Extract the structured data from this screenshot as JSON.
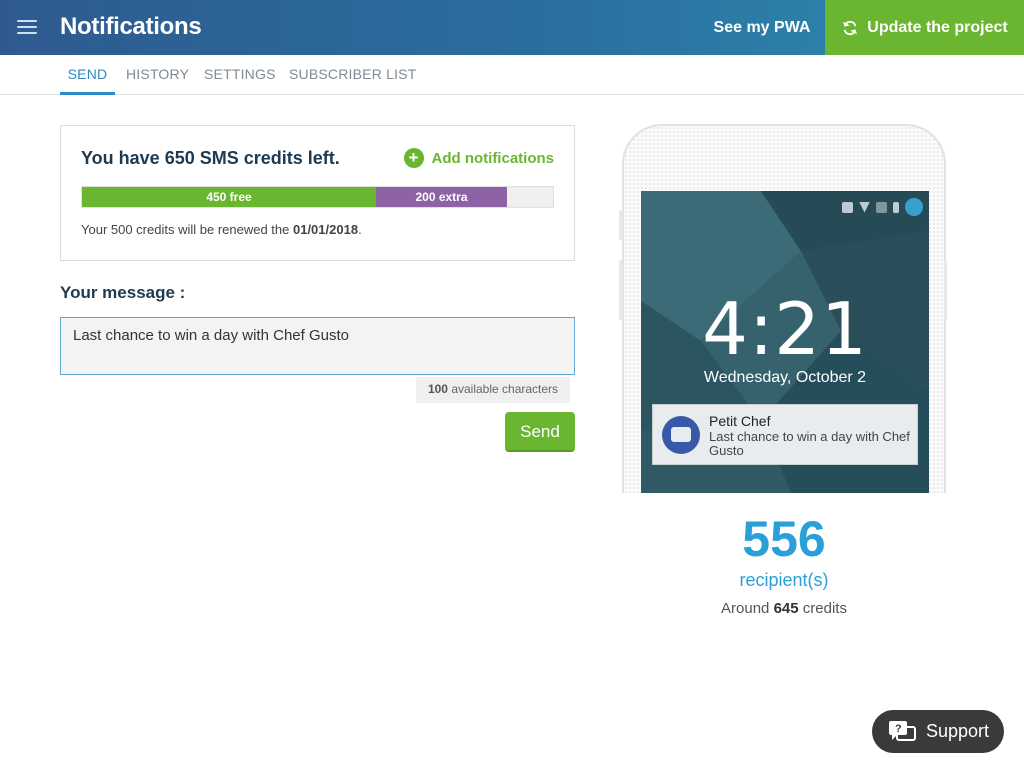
{
  "header": {
    "title": "Notifications",
    "see_pwa": "See my PWA",
    "update_project": "Update the project"
  },
  "tabs": [
    {
      "label": "SEND",
      "active": true
    },
    {
      "label": "HISTORY",
      "active": false
    },
    {
      "label": "SETTINGS",
      "active": false
    },
    {
      "label": "SUBSCRIBER LIST",
      "active": false
    }
  ],
  "credits": {
    "title": "You have 650 SMS credits left.",
    "add_label": "Add notifications",
    "free_label": "450 free",
    "extra_label": "200 extra",
    "free_count": 450,
    "extra_count": 200,
    "renew_prefix": "Your 500 credits will be renewed the ",
    "renew_date": "01/01/2018",
    "renew_suffix": "."
  },
  "message": {
    "label": "Your message :",
    "value": "Last chance to win a day with Chef Gusto",
    "chars_count": "100",
    "chars_text": " available characters",
    "send_label": "Send"
  },
  "preview": {
    "time": "4:21",
    "date": "Wednesday, October 2",
    "notif_app": "Petit Chef",
    "notif_text": "Last chance to win a day with Chef Gusto"
  },
  "recipients": {
    "count": "556",
    "label": "recipient(s)",
    "around_prefix": "Around ",
    "around_value": "645",
    "around_suffix": " credits"
  },
  "support": {
    "label": "Support"
  },
  "colors": {
    "accent_green": "#6ab630",
    "accent_blue": "#2a9fd8",
    "extra_purple": "#8e63a5",
    "header_start": "#2e5a8f",
    "header_end": "#2f8db1"
  },
  "icons": [
    "menu-icon",
    "refresh-icon",
    "plus-circle-icon",
    "vibrate-icon",
    "wifi-icon",
    "no-signal-icon",
    "battery-icon",
    "account-icon",
    "message-icon",
    "support-icon"
  ]
}
